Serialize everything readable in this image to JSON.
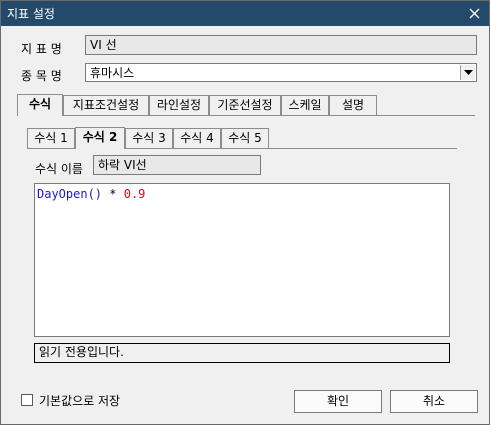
{
  "window": {
    "title": "지표 설정",
    "close_icon": "close-icon"
  },
  "form": {
    "indicator_name_label": "지 표 명",
    "indicator_name_value": "VI 선",
    "stock_name_label": "종 목 명",
    "stock_name_value": "휴마시스"
  },
  "main_tabs": [
    {
      "label": "수식",
      "active": true
    },
    {
      "label": "지표조건설정",
      "active": false
    },
    {
      "label": "라인설정",
      "active": false
    },
    {
      "label": "기준선설정",
      "active": false
    },
    {
      "label": "스케일",
      "active": false
    },
    {
      "label": "설명",
      "active": false
    }
  ],
  "formula_tabs": [
    {
      "label": "수식 1",
      "active": false
    },
    {
      "label": "수식 2",
      "active": true
    },
    {
      "label": "수식 3",
      "active": false
    },
    {
      "label": "수식 4",
      "active": false
    },
    {
      "label": "수식 5",
      "active": false
    }
  ],
  "formula": {
    "name_label": "수식 이름",
    "name_value": "하락 VI선",
    "code_func": "DayOpen()",
    "code_op": " * ",
    "code_num": "0.9",
    "func_color": "#1a1acc",
    "num_color": "#d01010"
  },
  "status_text": "읽기 전용입니다.",
  "footer": {
    "default_checkbox_label": "기본값으로 저장",
    "ok_label": "확인",
    "cancel_label": "취소"
  },
  "colors": {
    "titlebar": "#244a6b",
    "background": "#f0f0f0"
  }
}
